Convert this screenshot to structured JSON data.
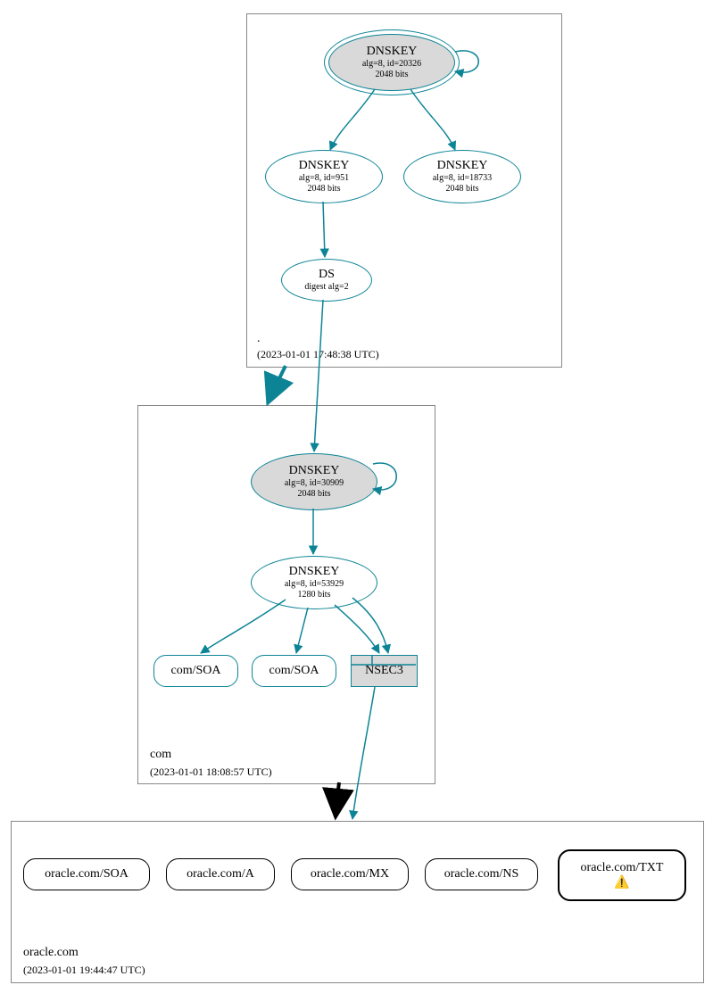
{
  "zones": {
    "root": {
      "label": ".",
      "timestamp": "(2023-01-01 17:48:38 UTC)",
      "nodes": {
        "dnskey_ksk": {
          "title": "DNSKEY",
          "line1": "alg=8, id=20326",
          "line2": "2048 bits"
        },
        "dnskey_951": {
          "title": "DNSKEY",
          "line1": "alg=8, id=951",
          "line2": "2048 bits"
        },
        "dnskey_18733": {
          "title": "DNSKEY",
          "line1": "alg=8, id=18733",
          "line2": "2048 bits"
        },
        "ds": {
          "title": "DS",
          "line1": "digest alg=2"
        }
      }
    },
    "com": {
      "label": "com",
      "timestamp": "(2023-01-01 18:08:57 UTC)",
      "nodes": {
        "dnskey_30909": {
          "title": "DNSKEY",
          "line1": "alg=8, id=30909",
          "line2": "2048 bits"
        },
        "dnskey_53929": {
          "title": "DNSKEY",
          "line1": "alg=8, id=53929",
          "line2": "1280 bits"
        },
        "soa1": {
          "label": "com/SOA"
        },
        "soa2": {
          "label": "com/SOA"
        },
        "nsec3": {
          "label": "NSEC3"
        }
      }
    },
    "oracle": {
      "label": "oracle.com",
      "timestamp": "(2023-01-01 19:44:47 UTC)",
      "nodes": {
        "soa": {
          "label": "oracle.com/SOA"
        },
        "a": {
          "label": "oracle.com/A"
        },
        "mx": {
          "label": "oracle.com/MX"
        },
        "ns": {
          "label": "oracle.com/NS"
        },
        "txt": {
          "label": "oracle.com/TXT",
          "warning": "⚠️"
        }
      }
    }
  }
}
